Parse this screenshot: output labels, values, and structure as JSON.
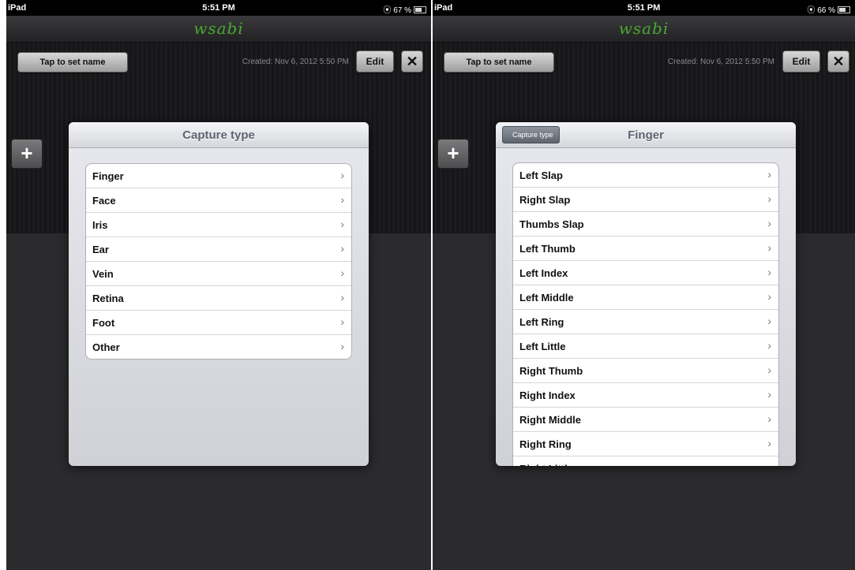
{
  "status": {
    "carrier": "iPad",
    "time": "5:51 PM",
    "left_battery": "67 %",
    "right_battery": "66 %",
    "lock_symbol": "⦿"
  },
  "app": {
    "logo": "wsabi"
  },
  "toolbar": {
    "name_button": "Tap to set name",
    "created": "Created: Nov 6, 2012 5:50 PM",
    "edit_button": "Edit",
    "close_symbol": "✕",
    "add_symbol": "+"
  },
  "left_popover": {
    "title": "Capture type",
    "items": [
      "Finger",
      "Face",
      "Iris",
      "Ear",
      "Vein",
      "Retina",
      "Foot",
      "Other"
    ]
  },
  "right_popover": {
    "title": "Finger",
    "back_button": "Capture type",
    "items": [
      "Left Slap",
      "Right Slap",
      "Thumbs Slap",
      "Left Thumb",
      "Left Index",
      "Left Middle",
      "Left Ring",
      "Left Little",
      "Right Thumb",
      "Right Index",
      "Right Middle",
      "Right Ring",
      "Right Little"
    ]
  },
  "chevron": "›",
  "colors": {
    "logo": "#4aa832",
    "background": "#2b2b2d"
  }
}
